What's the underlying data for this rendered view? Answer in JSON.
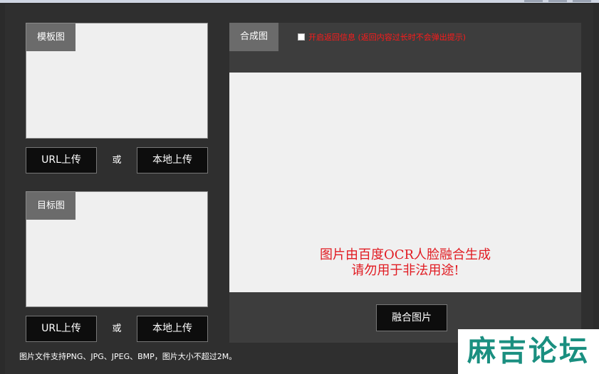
{
  "template": {
    "tag": "模板图",
    "url_upload": "URL上传",
    "or": "或",
    "local_upload": "本地上传"
  },
  "target": {
    "tag": "目标图",
    "url_upload": "URL上传",
    "or": "或",
    "local_upload": "本地上传"
  },
  "result": {
    "tag": "合成图",
    "checkbox_label": "开启返回信息 (返回内容过长时不会弹出提示)",
    "checkbox_checked": false,
    "notice_line1": "图片由百度OCR人脸融合生成",
    "notice_line2": "请勿用于非法用途!",
    "merge_button": "融合图片"
  },
  "footer": {
    "note": "图片文件支持PNG、JPG、JPEG、BMP，图片大小不超过2M。"
  },
  "watermark": {
    "text": "麻吉论坛"
  },
  "colors": {
    "background": "#2f2f2f",
    "panel": "#3d3d3d",
    "tag": "#6b6b6b",
    "button": "#0d0d0d",
    "notice": "#e11b22",
    "watermark": "#1a8f80"
  }
}
